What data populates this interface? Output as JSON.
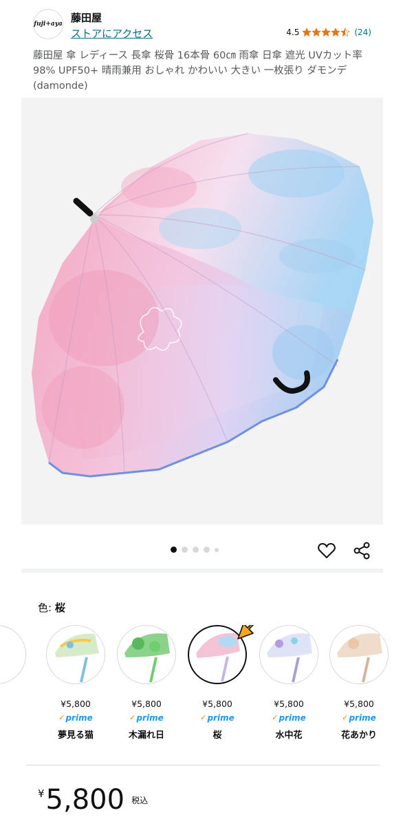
{
  "store": {
    "logo_text": "fuji+aya",
    "name": "藤田屋",
    "link": "ストアにアクセス",
    "rating_value": "4.5",
    "rating_stars": 4.5,
    "rating_count": "(24)"
  },
  "product": {
    "title": "藤田屋 傘 レディース 長傘 桜骨 16本骨 60㎝ 雨傘 日傘 遮光 UVカット率 98% UPF50+ 晴雨兼用 おしゃれ かわいい 大きい 一枚張り ダモンデ(damonde)"
  },
  "carousel": {
    "total": 5,
    "active": 1
  },
  "actions": {
    "wishlist_icon": "heart-icon",
    "share_icon": "share-icon"
  },
  "color": {
    "label": "色: ",
    "selected": "桜"
  },
  "variants": [
    {
      "price": "¥5,800",
      "prime": "prime",
      "name": "夢見る猫",
      "selected": false
    },
    {
      "price": "¥5,800",
      "prime": "prime",
      "name": "木漏れ日",
      "selected": false
    },
    {
      "price": "¥5,800",
      "prime": "prime",
      "name": "桜",
      "selected": true
    },
    {
      "price": "¥5,800",
      "prime": "prime",
      "name": "水中花",
      "selected": false
    },
    {
      "price": "¥5,800",
      "prime": "prime",
      "name": "花あかり",
      "selected": false
    }
  ],
  "price": {
    "currency": "¥",
    "amount": "5,800",
    "tax_note": "税込"
  },
  "colors": {
    "link": "#007185",
    "star": "#de7921",
    "prime": "#1a98ff",
    "arrow": "#f5a623"
  }
}
